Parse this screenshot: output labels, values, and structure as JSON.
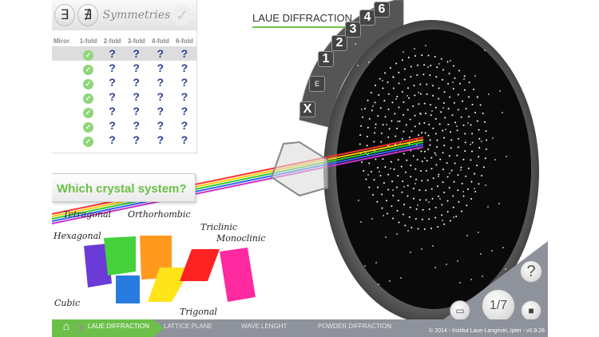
{
  "symmetries": {
    "exists_icon": "∃",
    "not_exists_icon": "∄",
    "title": "Symmetries",
    "confirm_icon": "✓",
    "columns": [
      "Miror",
      "1-fold",
      "2-fold",
      "3-fold",
      "4-fold",
      "6-fold"
    ],
    "rows": [
      [
        "",
        "✓",
        "?",
        "?",
        "?",
        "?"
      ],
      [
        "",
        "✓",
        "?",
        "?",
        "?",
        "?"
      ],
      [
        "",
        "✓",
        "?",
        "?",
        "?",
        "?"
      ],
      [
        "",
        "✓",
        "?",
        "?",
        "?",
        "?"
      ],
      [
        "",
        "✓",
        "?",
        "?",
        "?",
        "?"
      ],
      [
        "",
        "✓",
        "?",
        "?",
        "?",
        "?"
      ],
      [
        "",
        "✓",
        "?",
        "?",
        "?",
        "?"
      ]
    ]
  },
  "title": "LAUE DIFFRACTION",
  "dial": [
    "X",
    "E",
    "1",
    "2",
    "3",
    "4",
    "6"
  ],
  "question": "Which crystal system?",
  "crystals": [
    "Tetragonal",
    "Orthorhombic",
    "Hexagonal",
    "Triclinic",
    "Monoclinic",
    "Cubic",
    "Trigonal"
  ],
  "nav": {
    "home_icon": "⌂",
    "steps": [
      "LAUE DIFFRACTION",
      "LATTICE PLANE",
      "WAVE LENGHT",
      "POWDER DIFFRACTION"
    ]
  },
  "controls": {
    "help": "?",
    "page": "1/7",
    "book_icon": "book",
    "cube_icon": "cube"
  },
  "copyright": "© 2014 - Institut Laue-Langevin, Ipter - v0.9.26"
}
